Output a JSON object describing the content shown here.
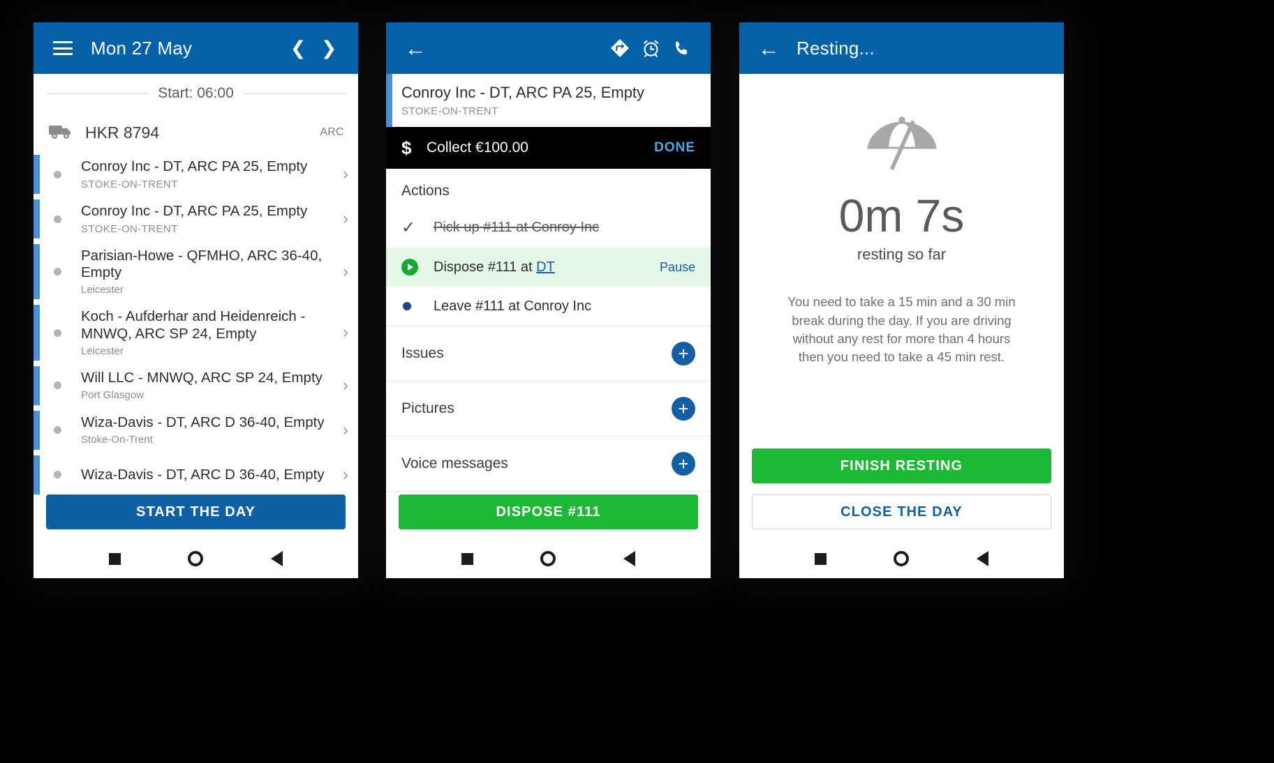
{
  "colors": {
    "appbar_blue": "#0561a8",
    "primary_blue": "#0e5fa4",
    "green": "#1bb934",
    "accent_link": "#4aa8e8",
    "timeline_bar": "#4a90d9",
    "active_row": "#e3f6e7"
  },
  "phone1": {
    "appbar": {
      "menu_icon": "hamburger-icon",
      "title": "Mon 27 May",
      "prev_icon": "chevron-left-icon",
      "next_icon": "chevron-right-icon"
    },
    "start_label": "Start: 06:00",
    "vehicle": {
      "icon": "truck-icon",
      "registration": "HKR 8794",
      "depot": "ARC"
    },
    "stops": [
      {
        "title": "Conroy Inc - DT, ARC PA 25, Empty",
        "location": "STOKE-ON-TRENT",
        "caps": true
      },
      {
        "title": "Conroy Inc - DT, ARC PA 25, Empty",
        "location": "STOKE-ON-TRENT",
        "caps": true
      },
      {
        "title": "Parisian-Howe - QFMHO, ARC 36-40, Empty",
        "location": "Leicester",
        "caps": false
      },
      {
        "title": "Koch - Aufderhar and Heidenreich - MNWQ, ARC SP 24, Empty",
        "location": "Leicester",
        "caps": false
      },
      {
        "title": "Will LLC - MNWQ, ARC SP 24, Empty",
        "location": "Port Glasgow",
        "caps": false
      },
      {
        "title": "Wiza-Davis - DT, ARC D 36-40, Empty",
        "location": "Stoke-On-Trent",
        "caps": false
      },
      {
        "title": "Wiza-Davis - DT, ARC D 36-40, Empty",
        "location": "",
        "caps": false
      }
    ],
    "start_day_button": "START THE DAY"
  },
  "phone2": {
    "appbar": {
      "back_icon": "arrow-back-icon",
      "directions_icon": "directions-icon",
      "alarm_icon": "alarm-clock-icon",
      "phone_icon": "phone-icon"
    },
    "job": {
      "title": "Conroy Inc - DT, ARC PA 25, Empty",
      "location": "STOKE-ON-TRENT"
    },
    "collect": {
      "currency_icon": "dollar-icon",
      "label": "Collect €100.00",
      "done_label": "DONE"
    },
    "actions_title": "Actions",
    "actions": [
      {
        "icon": "check-icon",
        "text": "Pick up #111 at Conroy Inc",
        "state": "done",
        "right": ""
      },
      {
        "icon": "play-icon",
        "text_before": "Dispose #111 at ",
        "link": "DT",
        "state": "active",
        "right": "Pause"
      },
      {
        "icon": "bullet-icon",
        "text": "Leave #111 at Conroy Inc",
        "state": "pending",
        "right": ""
      }
    ],
    "rows": [
      {
        "label": "Issues",
        "add_icon": "plus-icon"
      },
      {
        "label": "Pictures",
        "add_icon": "plus-icon"
      },
      {
        "label": "Voice messages",
        "add_icon": "plus-icon"
      }
    ],
    "dispose_button": "DISPOSE #111"
  },
  "phone3": {
    "appbar": {
      "back_icon": "arrow-back-icon",
      "title": "Resting..."
    },
    "umbrella_icon": "beach-umbrella-icon",
    "elapsed": "0m 7s",
    "elapsed_sub": "resting so far",
    "note": "You need to take a 15 min and a 30 min break during the day. If you are driving without any rest for more than 4 hours then you need to take a 45 min rest.",
    "finish_button": "FINISH RESTING",
    "close_button": "CLOSE THE DAY"
  },
  "navbar": {
    "recent_icon": "square-recents-icon",
    "home_icon": "circle-home-icon",
    "back_icon": "triangle-back-icon"
  }
}
